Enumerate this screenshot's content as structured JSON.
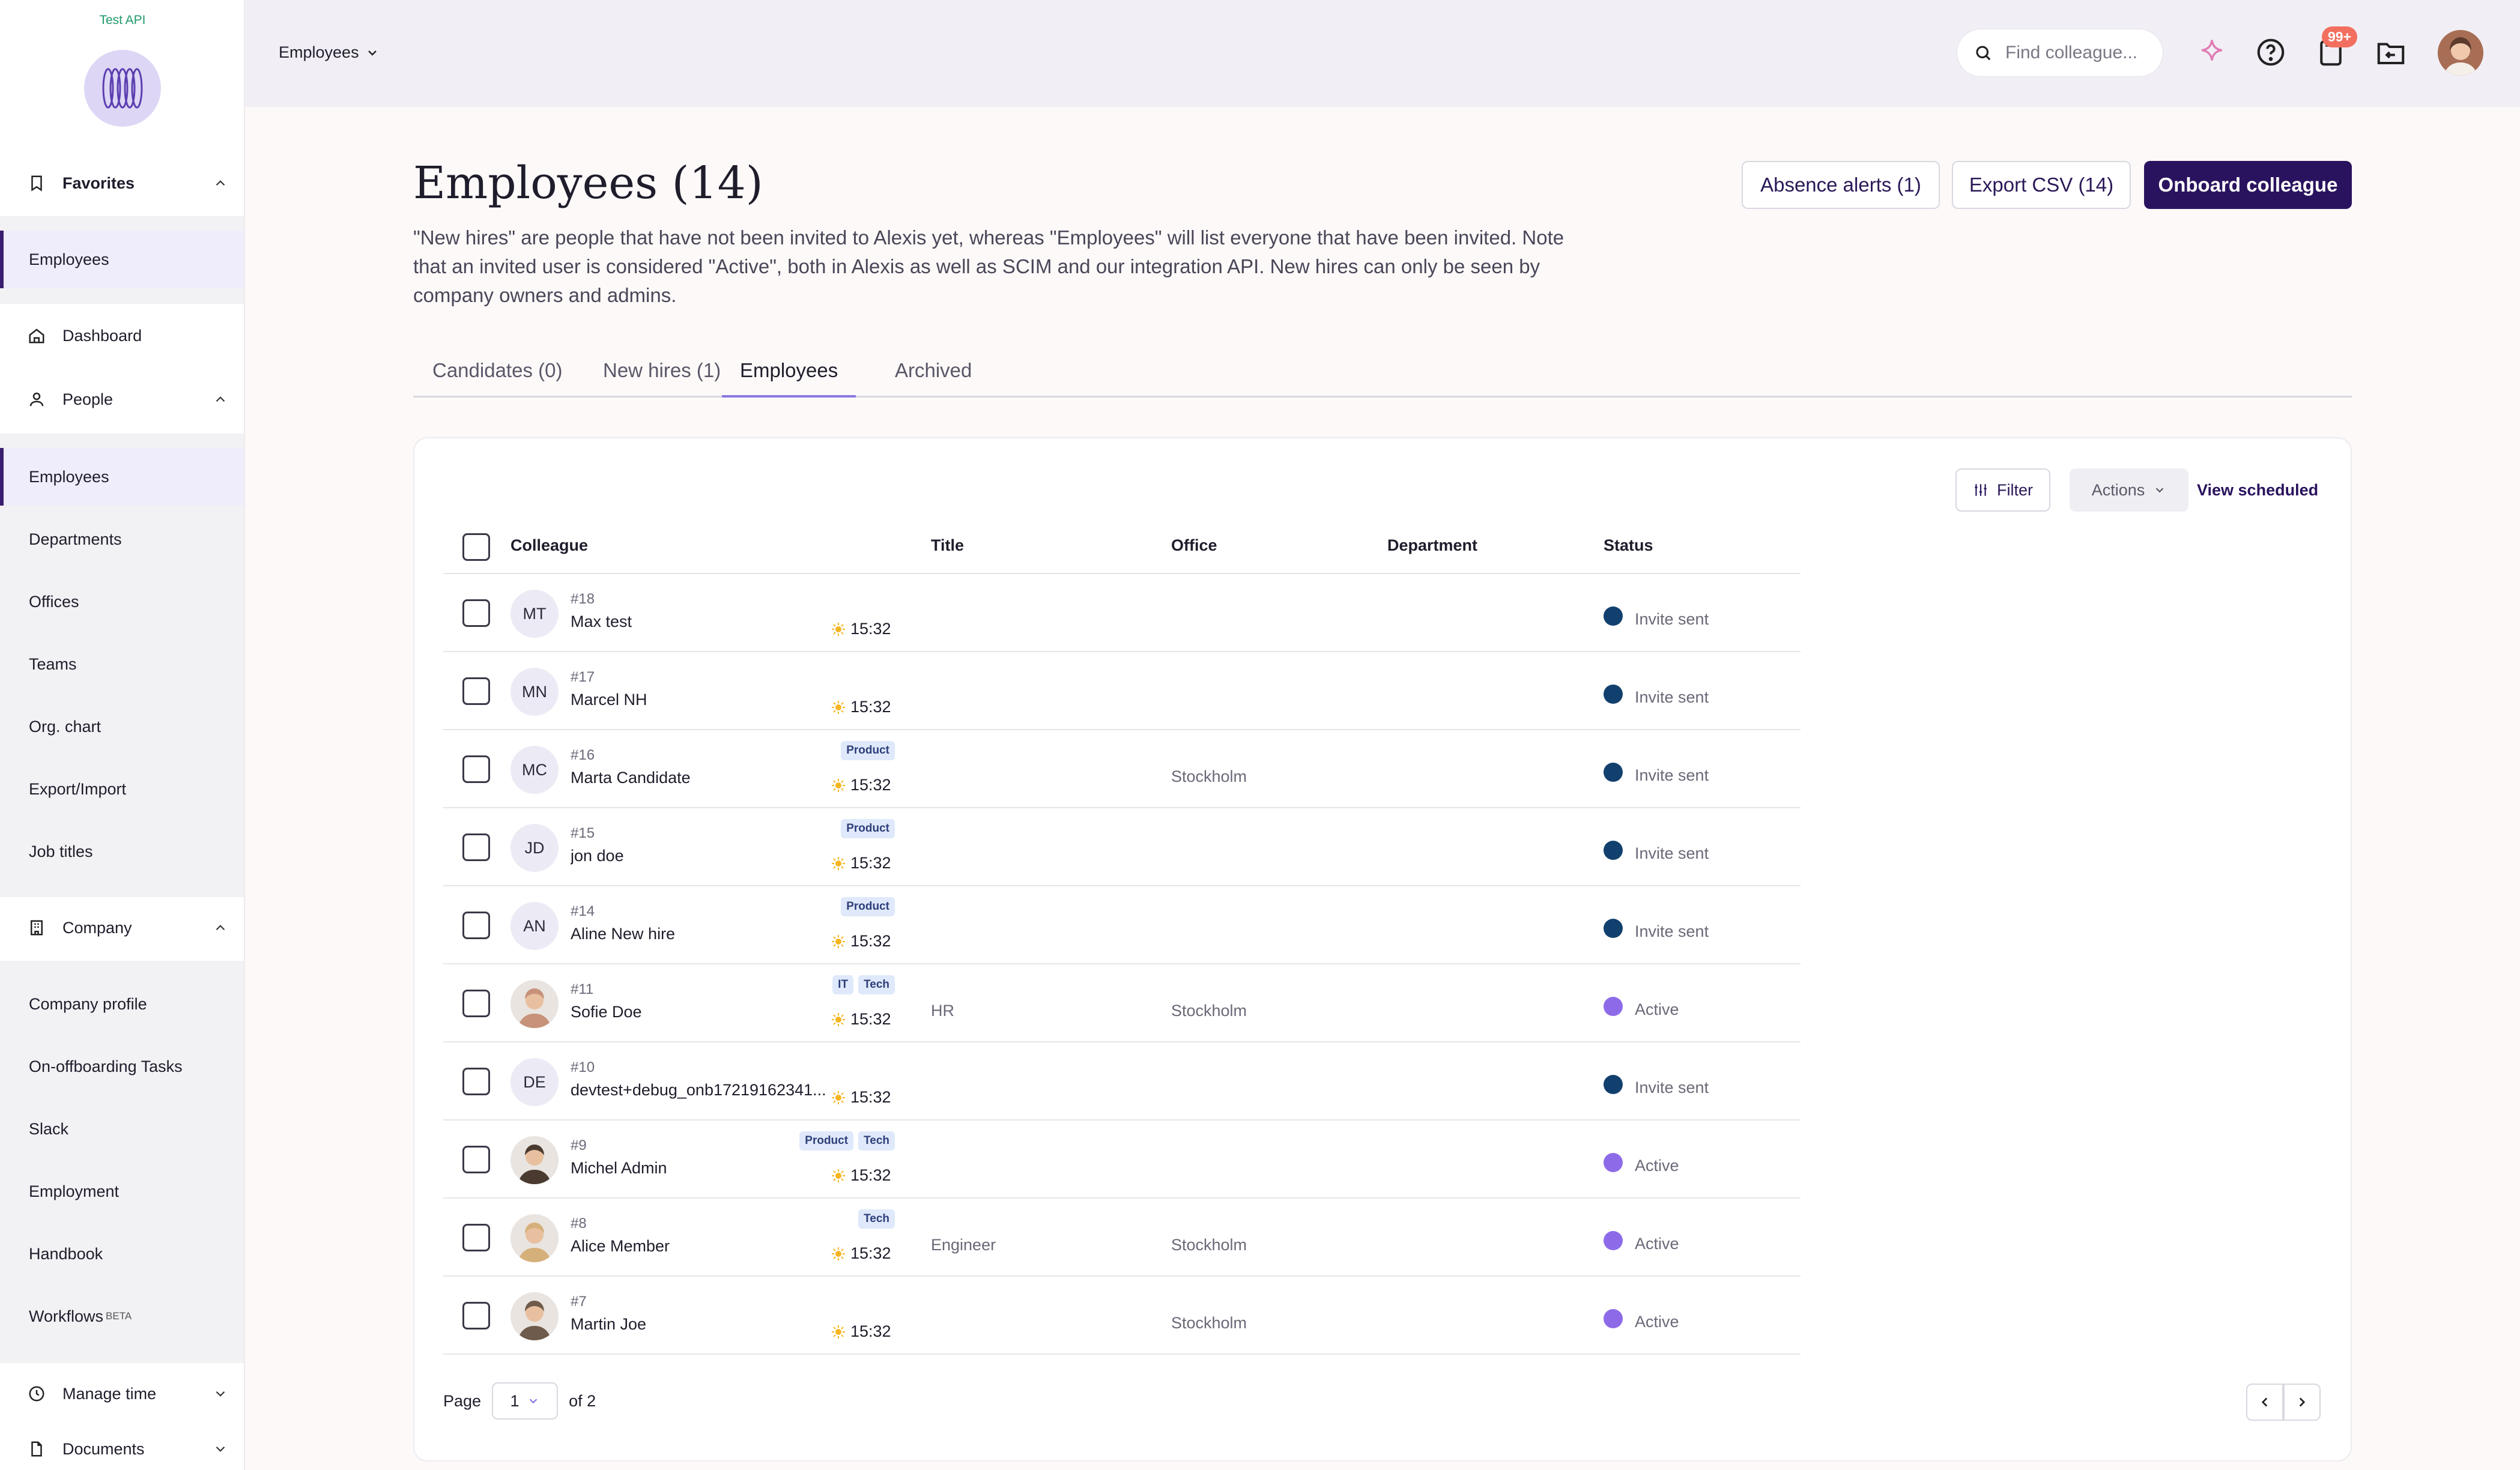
{
  "brand": "Test API",
  "sidebar": {
    "favorites": {
      "label": "Favorites",
      "items": [
        {
          "label": "Employees"
        }
      ]
    },
    "dashboard": "Dashboard",
    "people": {
      "label": "People",
      "items": [
        {
          "label": "Employees"
        },
        {
          "label": "Departments"
        },
        {
          "label": "Offices"
        },
        {
          "label": "Teams"
        },
        {
          "label": "Org. chart"
        },
        {
          "label": "Export/Import"
        },
        {
          "label": "Job titles"
        }
      ]
    },
    "company": {
      "label": "Company",
      "items": [
        {
          "label": "Company profile"
        },
        {
          "label": "On-offboarding Tasks"
        },
        {
          "label": "Slack"
        },
        {
          "label": "Employment"
        },
        {
          "label": "Handbook"
        },
        {
          "label": "Workflows",
          "badge": "BETA"
        }
      ]
    },
    "manage_time": "Manage time",
    "documents": "Documents"
  },
  "topbar": {
    "workspace": "Employees",
    "search_placeholder": "Find colleague...",
    "notification_badge": "99+"
  },
  "page": {
    "title": "Employees (14)",
    "description": "\"New hires\" are people that have not been invited to Alexis yet, whereas \"Employees\" will list everyone that have been invited. Note that an invited user is considered \"Active\", both in Alexis as well as SCIM and our integration API. New hires can only be seen by company owners and admins.",
    "buttons": {
      "absence": "Absence alerts (1)",
      "export": "Export CSV (14)",
      "onboard": "Onboard colleague"
    },
    "tabs": [
      "Candidates (0)",
      "New hires (1)",
      "Employees",
      "Archived"
    ]
  },
  "toolbar": {
    "filter": "Filter",
    "actions": "Actions",
    "view_scheduled": "View scheduled"
  },
  "table": {
    "headers": {
      "colleague": "Colleague",
      "title": "Title",
      "office": "Office",
      "department": "Department",
      "status": "Status"
    },
    "rows": [
      {
        "num": "#18",
        "name": "Max test",
        "initials": "MT",
        "tags": [],
        "time": "15:32",
        "title": "",
        "office": "",
        "status": "Invite sent"
      },
      {
        "num": "#17",
        "name": "Marcel NH",
        "initials": "MN",
        "tags": [],
        "time": "15:32",
        "title": "",
        "office": "",
        "status": "Invite sent"
      },
      {
        "num": "#16",
        "name": "Marta Candidate",
        "initials": "MC",
        "tags": [
          "Product"
        ],
        "time": "15:32",
        "title": "",
        "office": "Stockholm",
        "status": "Invite sent"
      },
      {
        "num": "#15",
        "name": "jon doe",
        "initials": "JD",
        "tags": [
          "Product"
        ],
        "time": "15:32",
        "title": "",
        "office": "",
        "status": "Invite sent"
      },
      {
        "num": "#14",
        "name": "Aline New hire",
        "initials": "AN",
        "tags": [
          "Product"
        ],
        "time": "15:32",
        "title": "",
        "office": "",
        "status": "Invite sent"
      },
      {
        "num": "#11",
        "name": "Sofie Doe",
        "initials": "",
        "tags": [
          "IT",
          "Tech"
        ],
        "time": "15:32",
        "title": "HR",
        "office": "Stockholm",
        "status": "Active"
      },
      {
        "num": "#10",
        "name": "devtest+debug_onb17219162341...",
        "initials": "DE",
        "tags": [],
        "time": "15:32",
        "title": "",
        "office": "",
        "status": "Invite sent"
      },
      {
        "num": "#9",
        "name": "Michel Admin",
        "initials": "",
        "tags": [
          "Product",
          "Tech"
        ],
        "time": "15:32",
        "title": "",
        "office": "",
        "status": "Active"
      },
      {
        "num": "#8",
        "name": "Alice Member",
        "initials": "",
        "tags": [
          "Tech"
        ],
        "time": "15:32",
        "title": "Engineer",
        "office": "Stockholm",
        "status": "Active"
      },
      {
        "num": "#7",
        "name": "Martin Joe",
        "initials": "",
        "tags": [],
        "time": "15:32",
        "title": "",
        "office": "Stockholm",
        "status": "Active"
      }
    ]
  },
  "pagination": {
    "page_label": "Page",
    "current": "1",
    "of_label": "of 2"
  },
  "colors": {
    "invite_sent": "#12406e",
    "active": "#8d6be8",
    "primary": "#2a135e"
  }
}
